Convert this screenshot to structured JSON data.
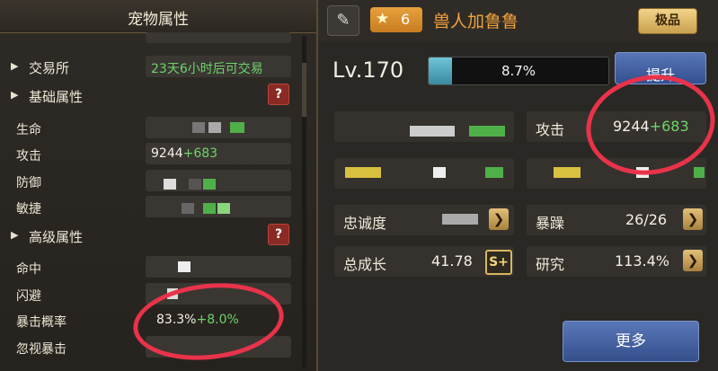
{
  "left_panel": {
    "title": "宠物属性",
    "top_partial": "",
    "rows": {
      "exchange": {
        "label": "交易所",
        "value": "23天6小时后可交易"
      },
      "basic": {
        "label": "基础属性",
        "help": "?"
      },
      "hp": {
        "label": "生命"
      },
      "attack": {
        "label": "攻击",
        "base": "9244",
        "bonus": "+683"
      },
      "defense": {
        "label": "防御"
      },
      "agility": {
        "label": "敏捷"
      },
      "advanced": {
        "label": "高级属性",
        "help": "?"
      },
      "hit": {
        "label": "命中"
      },
      "dodge": {
        "label": "闪避"
      },
      "crit_rate": {
        "label": "暴击概率",
        "base": "83.3%",
        "bonus": "+8.0%"
      },
      "ignore_crit": {
        "label": "忽视暴击"
      }
    }
  },
  "header": {
    "edit_icon": "pencil-icon",
    "star_count": "6",
    "pet_name": "兽人加鲁鲁",
    "rank": "极品"
  },
  "level": {
    "label": "Lv.170",
    "exp_percent_text": "8.7%",
    "exp_fraction": 0.087,
    "upgrade_label": "提升"
  },
  "stats": {
    "attack": {
      "label": "攻击",
      "base": "9244",
      "bonus": "+683"
    },
    "loyalty": {
      "label": "忠诚度"
    },
    "irritable": {
      "label": "暴躁",
      "value": "26/26"
    },
    "growth": {
      "label": "总成长",
      "value": "41.78",
      "grade": "S+"
    },
    "research": {
      "label": "研究",
      "value": "113.4%"
    }
  },
  "more_label": "更多",
  "colors": {
    "accent_orange": "#f2a13a",
    "bonus_green": "#6fd36a",
    "highlight_red": "#e8334a"
  }
}
